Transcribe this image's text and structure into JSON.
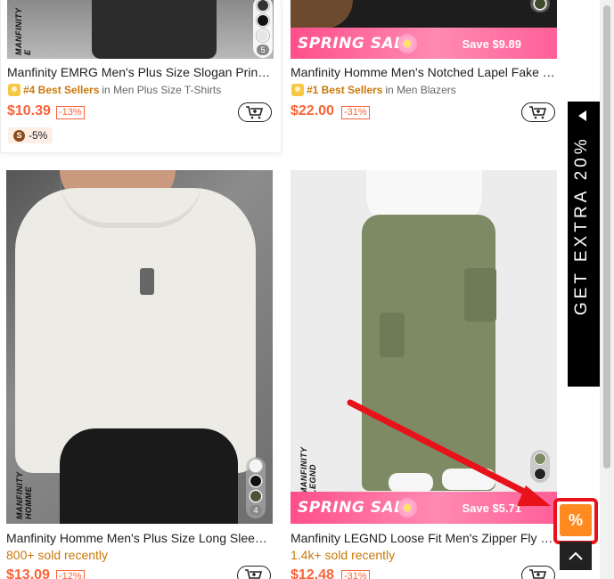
{
  "products": [
    {
      "title": "Manfinity EMRG Men's Plus Size Slogan Print…",
      "rank_label": "#4 Best Sellers",
      "rank_category": "in Men Plus Size T-Shirts",
      "price": "$10.39",
      "discount": "-13%",
      "coupon": "-5%",
      "coupon_icon": "S",
      "swatch_count": "5"
    },
    {
      "title": "Manfinity Homme Men's Notched Lapel Fake …",
      "rank_label": "#1 Best Sellers",
      "rank_category": "in Men Blazers",
      "price": "$22.00",
      "discount": "-31%",
      "banner_text": "SPRING SALE",
      "banner_save": "Save $9.89"
    },
    {
      "title": "Manfinity Homme Men's Plus Size Long Slee…",
      "sold": "800+ sold recently",
      "price": "$13.09",
      "discount": "-12%",
      "brand_watermark": "MANFINITY HOMME",
      "swatch_count": "4"
    },
    {
      "title": "Manfinity LEGND Loose Fit Men's Zipper Fly …",
      "sold": "1.4k+ sold recently",
      "price": "$12.48",
      "discount": "-31%",
      "banner_text": "SPRING SALE",
      "banner_save": "Save $5.71",
      "brand_watermark": "MANFINITY LEGND"
    }
  ],
  "side_promo": {
    "text": "GET EXTRA 20%"
  },
  "promo_button": {
    "symbol": "%"
  },
  "colors": {
    "price": "#fa6338",
    "banner": "#ff5f98",
    "highlight": "#e8121a",
    "promo": "#ff8a1f"
  },
  "icons": [
    "cart-add-icon",
    "medal-icon",
    "chevron-left-icon",
    "chevron-up-icon",
    "percent-icon",
    "coin-icon"
  ]
}
